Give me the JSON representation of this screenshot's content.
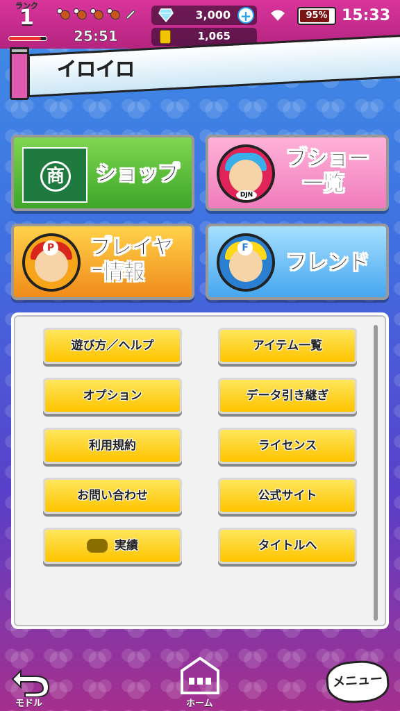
{
  "status": {
    "rank_label": "ランク",
    "rank": "1",
    "rank_progress": 0.85,
    "stamina_full": 4,
    "stamina_total": 5,
    "timer": "25:51",
    "gems": "3,000",
    "coins": "1,065",
    "battery": "95%",
    "clock": "15:33"
  },
  "banner": {
    "title": "イロイロ"
  },
  "tiles": {
    "shop": "ショップ",
    "busho_line1": "ブショー",
    "busho_line2": "一覧",
    "busho_badge": "DJN",
    "player_line1": "プレイヤー",
    "player_line2": "情報",
    "player_badge": "P",
    "friend": "フレンド",
    "friend_badge": "F"
  },
  "menu": {
    "howto": "遊び方／ヘルプ",
    "items": "アイテム一覧",
    "options": "オプション",
    "transfer": "データ引き継ぎ",
    "terms": "利用規約",
    "license": "ライセンス",
    "contact": "お問い合わせ",
    "official": "公式サイト",
    "achievements": "実績",
    "title": "タイトルへ"
  },
  "nav": {
    "back": "モドル",
    "home": "ホーム",
    "menu": "メニュー"
  },
  "colors": {
    "accent_pink": "#d9349b",
    "button_yellow": "#ffc400",
    "shop_green": "#3da629",
    "busho_pink": "#f07cbc",
    "player_orange": "#f08b1a",
    "friend_blue": "#46a6ef"
  }
}
